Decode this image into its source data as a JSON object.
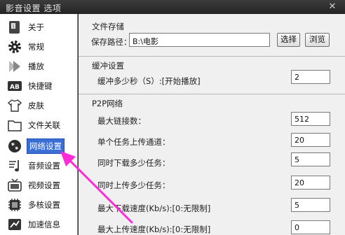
{
  "window": {
    "title": "影音设置 选项",
    "close_glyph": "✕"
  },
  "sidebar": {
    "items": [
      {
        "label": "关于",
        "icon": "info-card-icon"
      },
      {
        "label": "常规",
        "icon": "gear-icon"
      },
      {
        "label": "播放",
        "icon": "play-arrows-icon"
      },
      {
        "label": "快捷键",
        "icon": "ab-key-icon"
      },
      {
        "label": "皮肤",
        "icon": "shirt-icon"
      },
      {
        "label": "文件关联",
        "icon": "folder-icon"
      },
      {
        "label": "网络设置",
        "icon": "globe-icon"
      },
      {
        "label": "音频设置",
        "icon": "music-note-icon"
      },
      {
        "label": "视频设置",
        "icon": "tv-icon"
      },
      {
        "label": "多核设置",
        "icon": "chip-icon"
      },
      {
        "label": "加速信息",
        "icon": "speed-icon"
      }
    ],
    "active_index": 6
  },
  "file_storage": {
    "title": "文件存储",
    "path_label": "保存路径：",
    "path_value": "B:\\电影",
    "select_button": "选择",
    "browse_button": "浏览"
  },
  "buffer": {
    "title": "缓冲设置",
    "seconds_label": "缓冲多少秒（S）:[开始播放]",
    "seconds_value": "2"
  },
  "p2p": {
    "title": "P2P网络",
    "max_links_label": "最大链接数：",
    "max_links_value": "512",
    "upload_channels_label": "单个任务上传通道：",
    "upload_channels_value": "20",
    "concurrent_download_label": "同时下载多少任务：",
    "concurrent_download_value": "5",
    "concurrent_upload_label": "同时上传多少任务：",
    "concurrent_upload_value": "20",
    "max_download_speed_label": "最大下载速度(Kb/s):[0:无限制]",
    "max_download_speed_value": "5",
    "max_upload_speed_label": "最大上传速度(Kb/s):[0:无限制]",
    "max_upload_speed_value": "0"
  },
  "colors": {
    "arrow": "#ff2bd6",
    "active_bg": "#3a6fd6"
  }
}
